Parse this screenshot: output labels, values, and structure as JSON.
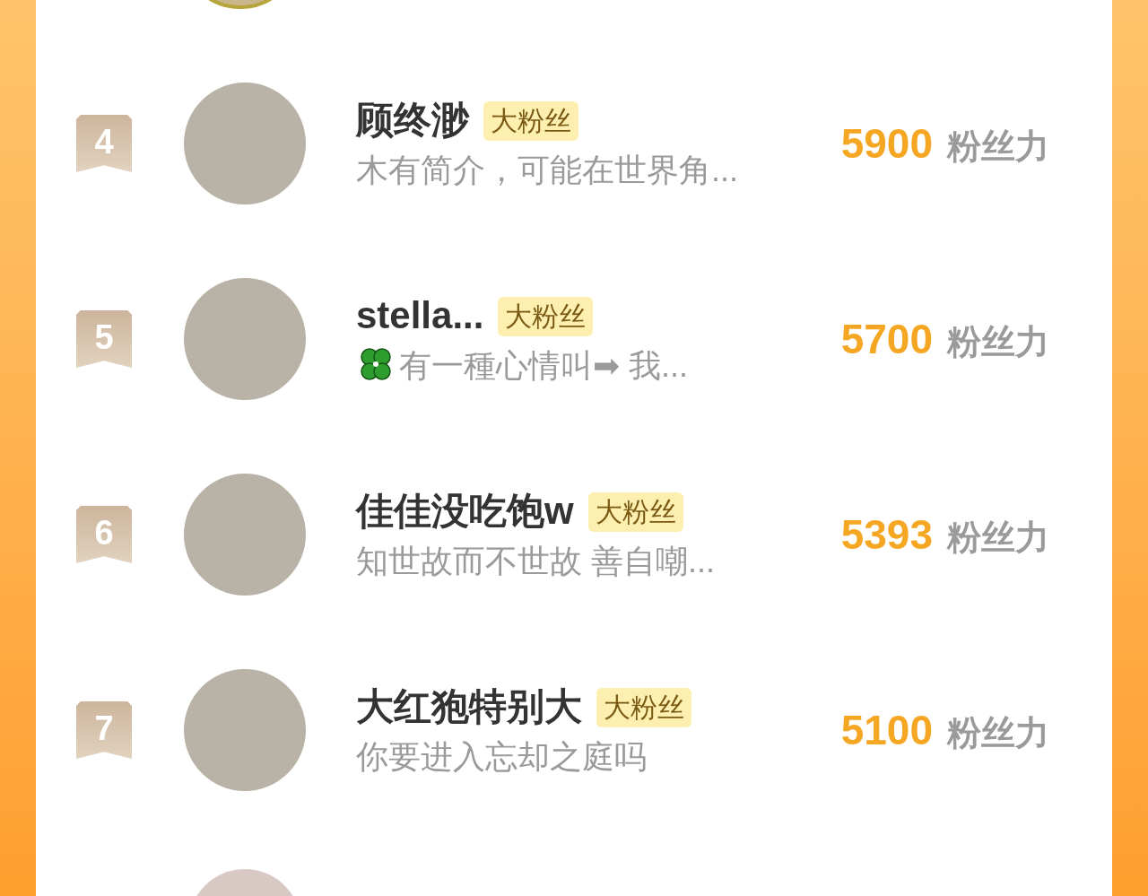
{
  "rows": [
    {
      "rank": "4",
      "name": "顾终渺",
      "badge": "大粉丝",
      "bio": "木有简介，可能在世界角...",
      "bio_icon": false,
      "score": "5900",
      "score_unit": "粉丝力"
    },
    {
      "rank": "5",
      "name": "stella...",
      "badge": "大粉丝",
      "bio": "有一種心情叫➡ 我...",
      "bio_icon": true,
      "score": "5700",
      "score_unit": "粉丝力"
    },
    {
      "rank": "6",
      "name": "佳佳没吃饱w",
      "badge": "大粉丝",
      "bio": "知世故而不世故 善自嘲...",
      "bio_icon": false,
      "score": "5393",
      "score_unit": "粉丝力"
    },
    {
      "rank": "7",
      "name": "大红狍特别大",
      "badge": "大粉丝",
      "bio": "你要进入忘却之庭吗",
      "bio_icon": false,
      "score": "5100",
      "score_unit": "粉丝力"
    }
  ]
}
